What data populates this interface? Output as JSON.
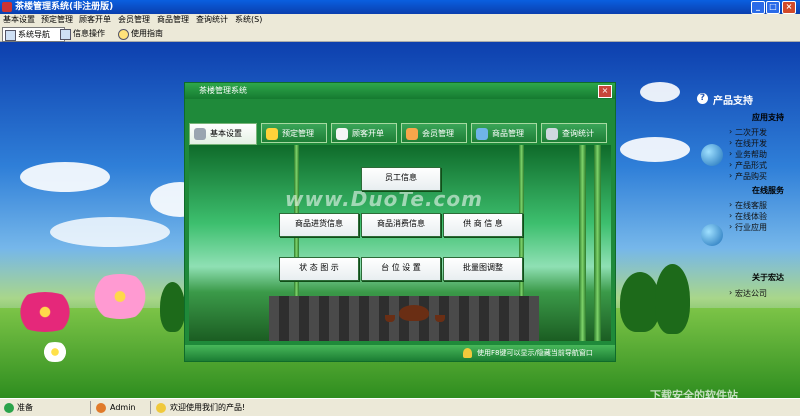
{
  "window": {
    "title": "茶楼管理系统(非注册版)"
  },
  "menu": [
    "基本设置",
    "预定管理",
    "顾客开单",
    "会员管理",
    "商品管理",
    "查询统计",
    "系统(S)"
  ],
  "toolbar": {
    "nav": "系统导航",
    "info": "信息操作",
    "guide": "使用指南"
  },
  "dialog": {
    "title": "茶楼管理系统",
    "tabs": [
      "基本设置",
      "预定管理",
      "顾客开单",
      "会员管理",
      "商品管理",
      "查询统计"
    ],
    "buttons": {
      "staff": "员工信息",
      "stock": "商品进货信息",
      "consume": "商品消费信息",
      "supplier": "供 商 信 息",
      "status": "状 态 图 示",
      "table_setting": "台 位 设 置",
      "batch": "批量图调整"
    },
    "watermark": "www.DuoTe.com",
    "status": "使用F8键可以显示/隐藏当前导航窗口"
  },
  "support": {
    "title": "产品支持",
    "sections": [
      {
        "name": "应用支持",
        "links": [
          "二次开发",
          "在线开发",
          "业务帮助",
          "产品形式",
          "产品购买"
        ]
      },
      {
        "name": "在线服务",
        "links": [
          "在线客服",
          "在线体验",
          "行业应用"
        ]
      },
      {
        "name": "关于宏达",
        "links": [
          "宏达公司"
        ]
      }
    ]
  },
  "statusbar": {
    "ready": "准备",
    "user": "Admin",
    "welcome": "欢迎使用我们的产品!"
  },
  "watermark2": "下载安全的软件站",
  "colors": {
    "titlebar": "#0a4fd0",
    "dialog": "#1f8a3a",
    "accent": "#2a5bb5"
  }
}
